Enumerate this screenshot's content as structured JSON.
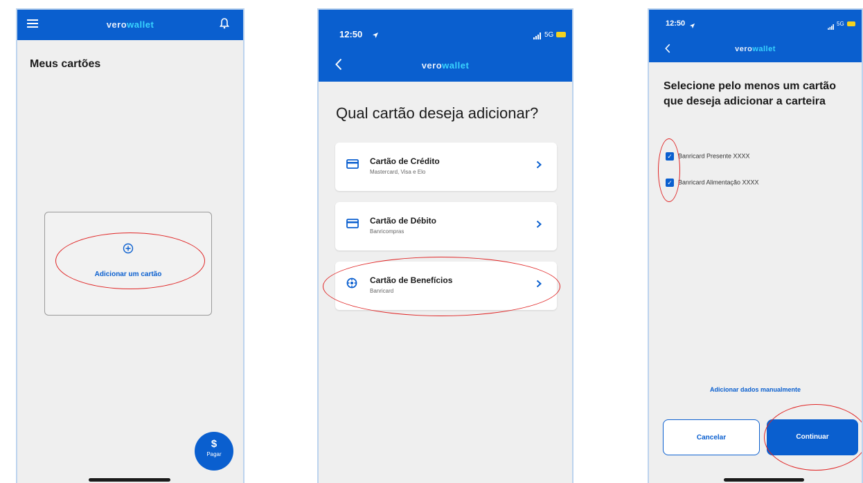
{
  "brand": {
    "part1": "vero",
    "part2": "wallet"
  },
  "panel1": {
    "title": "Meus cartões",
    "add_card_label": "Adicionar um cartão",
    "pay_symbol": "$",
    "pay_label": "Pagar"
  },
  "panel2": {
    "time": "12:50",
    "signal": "5G",
    "question": "Qual cartão deseja adicionar?",
    "options": [
      {
        "title": "Cartão de Crédito",
        "subtitle": "Mastercard, Visa e Elo",
        "icon": "credit-card-icon"
      },
      {
        "title": "Cartão de Débito",
        "subtitle": "Banricompras",
        "icon": "debit-card-icon"
      },
      {
        "title": "Cartão de Benefícios",
        "subtitle": "Banricard",
        "icon": "benefits-icon"
      }
    ]
  },
  "panel3": {
    "time": "12:50",
    "signal": "5G",
    "heading": "Selecione pelo menos um cartão que deseja adicionar a carteira",
    "cards": [
      {
        "label": "Banricard Presente XXXX",
        "checked": true
      },
      {
        "label": "Banricard Alimentação XXXX",
        "checked": true
      }
    ],
    "manual_link": "Adicionar dados manualmente",
    "cancel_label": "Cancelar",
    "continue_label": "Continuar"
  },
  "colors": {
    "primary": "#0a5fcf",
    "highlight": "#e02424",
    "logo_accent": "#38d4ff"
  }
}
